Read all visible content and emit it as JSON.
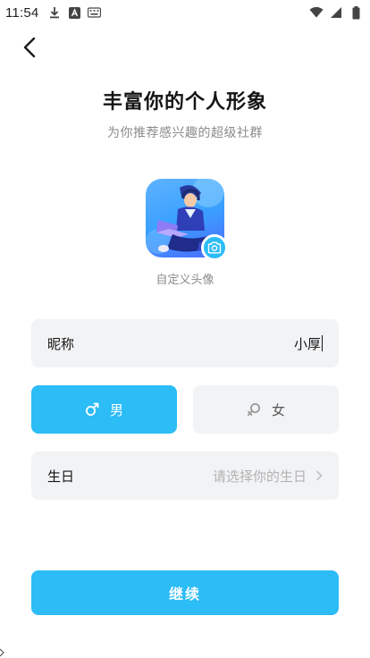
{
  "status_bar": {
    "time": "11:54",
    "left_icons": [
      "download-icon",
      "font-app-icon",
      "keyboard-icon"
    ],
    "right_icons": [
      "wifi-icon",
      "signal-icon",
      "battery-icon"
    ]
  },
  "header": {
    "title": "丰富你的个人形象",
    "subtitle": "为你推荐感兴趣的超级社群"
  },
  "avatar": {
    "label": "自定义头像"
  },
  "nickname": {
    "label": "昵称",
    "value": "小厚"
  },
  "gender": {
    "male_label": "男",
    "female_label": "女",
    "selected": "male"
  },
  "birthday": {
    "label": "生日",
    "placeholder": "请选择你的生日"
  },
  "actions": {
    "continue_label": "继续"
  },
  "colors": {
    "accent": "#2cbcf6",
    "field_bg": "#f2f3f5",
    "muted_text": "#8b8b8b",
    "placeholder_text": "#b2b2b2"
  }
}
